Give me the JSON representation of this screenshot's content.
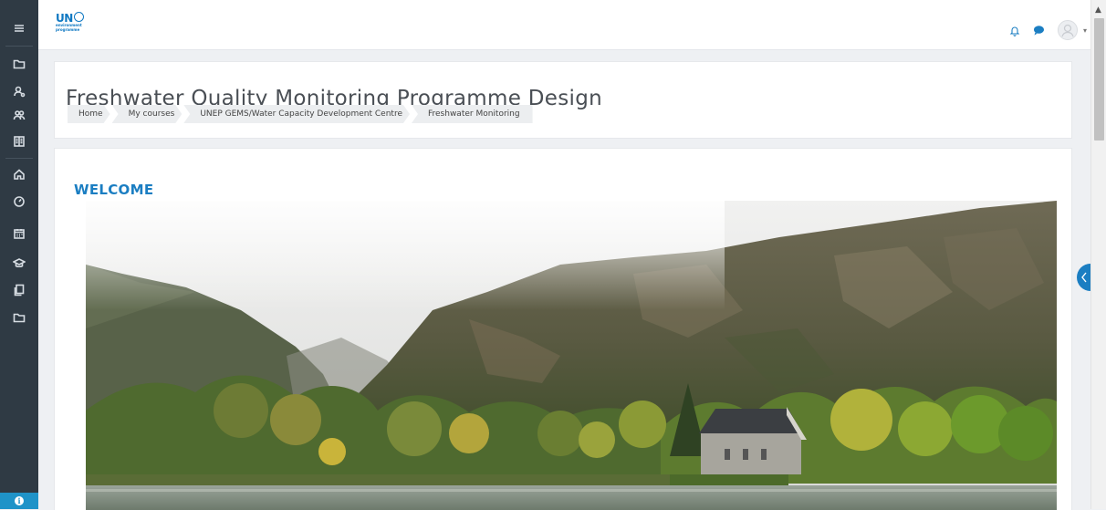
{
  "rail": {
    "items": [
      {
        "name": "menu-icon"
      },
      {
        "name": "folder-icon"
      },
      {
        "name": "user-settings-icon"
      },
      {
        "name": "users-icon"
      },
      {
        "name": "book-icon"
      },
      {
        "name": "home-icon"
      },
      {
        "name": "dashboard-icon"
      },
      {
        "name": "calendar-icon"
      },
      {
        "name": "graduation-cap-icon"
      },
      {
        "name": "files-icon"
      },
      {
        "name": "folder-icon"
      }
    ],
    "info_icon": "info-icon"
  },
  "logo": {
    "line1": "UN",
    "line2": "environment",
    "line3": "programme"
  },
  "header": {
    "icons": [
      "bell-icon",
      "chat-icon",
      "avatar",
      "chevron-down-icon"
    ]
  },
  "page": {
    "title": "Freshwater Quality Monitoring Programme Design",
    "breadcrumb": [
      "Home",
      "My courses",
      "UNEP GEMS/Water Capacity Development Centre",
      "Freshwater Monitoring"
    ]
  },
  "main": {
    "section_title": "WELCOME",
    "hero_image": "Lakeside chapel below misty mountains"
  },
  "colors": {
    "accent": "#1b7ec2",
    "rail": "#2f3a44",
    "logo": "#0f78c2"
  }
}
